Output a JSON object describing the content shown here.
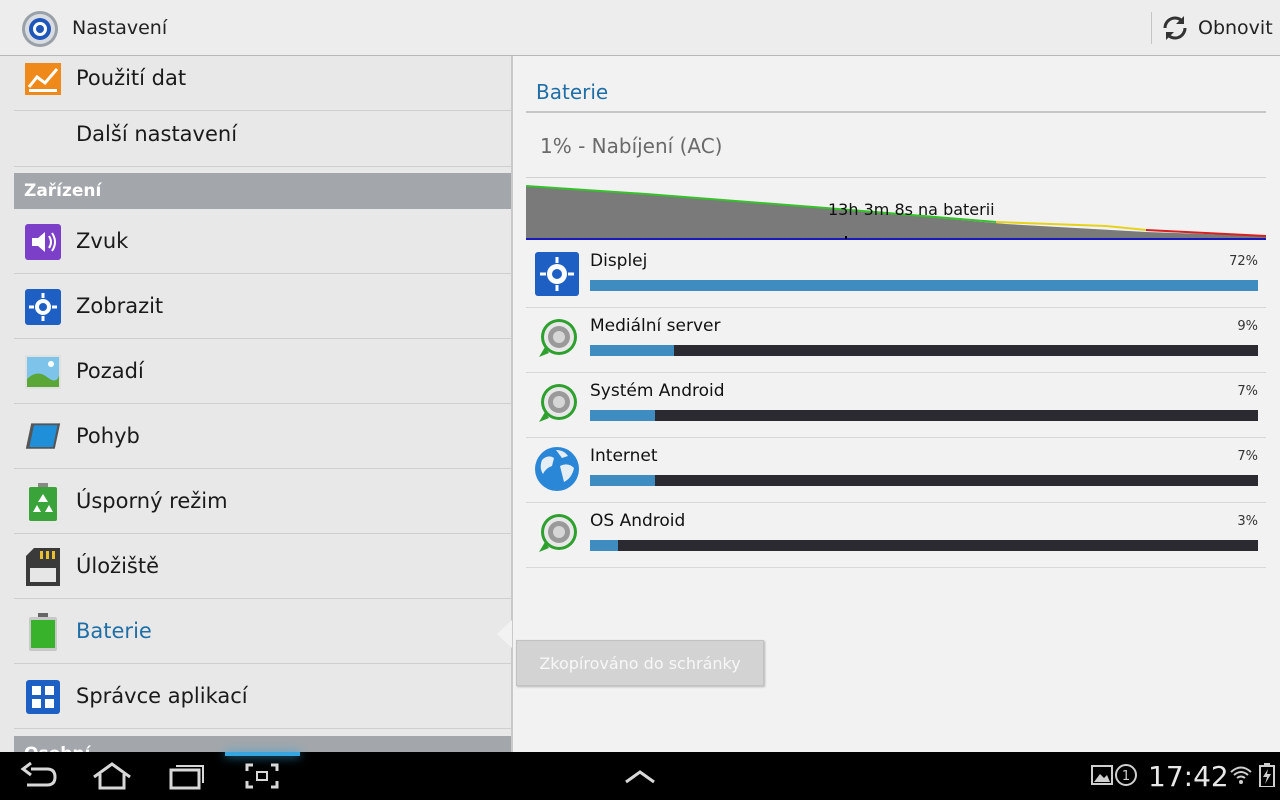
{
  "app": {
    "title": "Nastavení",
    "refresh_label": "Obnovit"
  },
  "left": {
    "items": [
      {
        "label": "Použití dat",
        "icon": "data-usage-icon"
      },
      {
        "label": "Další nastavení",
        "icon": ""
      },
      {
        "label": "Zvuk",
        "icon": "sound-icon"
      },
      {
        "label": "Zobrazit",
        "icon": "display-icon"
      },
      {
        "label": "Pozadí",
        "icon": "wallpaper-icon"
      },
      {
        "label": "Pohyb",
        "icon": "motion-icon"
      },
      {
        "label": "Úsporný režim",
        "icon": "power-saving-icon"
      },
      {
        "label": "Úložiště",
        "icon": "storage-icon"
      },
      {
        "label": "Baterie",
        "icon": "battery-icon",
        "selected": true
      },
      {
        "label": "Správce aplikací",
        "icon": "app-manager-icon"
      }
    ],
    "section_device": "Zařízení",
    "section_next": "Osobní"
  },
  "right": {
    "title": "Baterie",
    "status": "1% - Nabíjení (AC)",
    "graph_label": "13h 3m 8s na baterii",
    "usage": [
      {
        "name": "Displej",
        "percent": "72%",
        "value": 72,
        "icon": "display-icon"
      },
      {
        "name": "Mediální server",
        "percent": "9%",
        "value": 9,
        "icon": "android-gear-icon"
      },
      {
        "name": "Systém Android",
        "percent": "7%",
        "value": 7,
        "icon": "android-gear-icon"
      },
      {
        "name": "Internet",
        "percent": "7%",
        "value": 7,
        "icon": "globe-icon"
      },
      {
        "name": "OS Android",
        "percent": "3%",
        "value": 3,
        "icon": "android-gear-icon"
      }
    ]
  },
  "toast": "Zkopírováno do schránky",
  "statusbar": {
    "time": "17:42",
    "notification_count": "1"
  },
  "colors": {
    "accent": "#1f6fa6",
    "bar_fill": "#3e8cc0",
    "bar_track": "#2a2a30"
  }
}
